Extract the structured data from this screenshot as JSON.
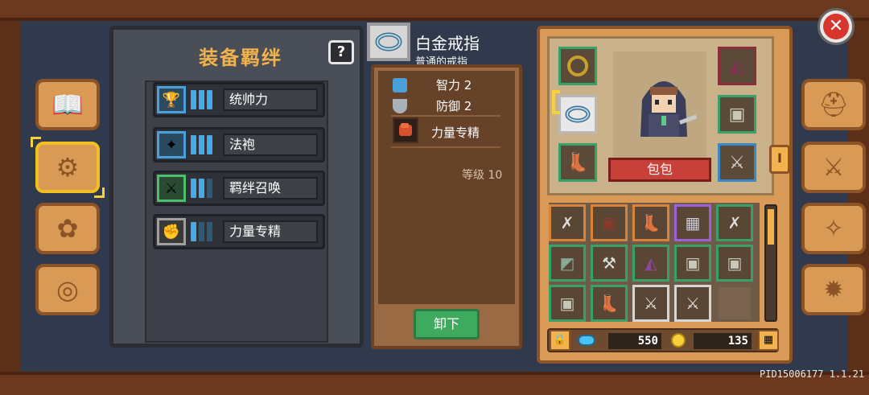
{
  "colors": {
    "accent_gold": "#f2b24d",
    "wood": "#d89a55",
    "green_button": "#3eaa5e",
    "close_red": "#d8362c"
  },
  "left_tabs": [
    {
      "icon": "book-icon",
      "glyph": "📖"
    },
    {
      "icon": "equipment-bond-icon",
      "glyph": "⚙",
      "active": true
    },
    {
      "icon": "pet-icon",
      "glyph": "✿"
    },
    {
      "icon": "steering-wheel-icon",
      "glyph": "◎"
    }
  ],
  "bond": {
    "title": "装备羁绊",
    "help": "?",
    "rows": [
      {
        "label": "统帅力",
        "icon": "trophy-icon",
        "glyph": "🏆",
        "bars_on": 3,
        "bars_total": 3
      },
      {
        "label": "法袍",
        "icon": "robe-icon",
        "glyph": "✦",
        "bars_on": 3,
        "bars_total": 3
      },
      {
        "label": "羁绊召唤",
        "icon": "summon-sword-icon",
        "glyph": "⚔",
        "bars_on": 2,
        "bars_total": 3
      },
      {
        "label": "力量专精",
        "icon": "fist-icon",
        "glyph": "✊",
        "bars_on": 1,
        "bars_total": 3
      }
    ]
  },
  "item": {
    "name": "白金戒指",
    "quality": "普通的戒指",
    "stats": [
      {
        "label": "智力 2",
        "icon": "intelligence-icon",
        "color": "#4aa0d8"
      },
      {
        "label": "防御 2",
        "icon": "defense-shield-icon",
        "color": "#a8b0b8"
      }
    ],
    "skill": "力量专精",
    "level": "等级 10",
    "unequip": "卸下"
  },
  "equipment": {
    "bag_label": "包包",
    "currency": {
      "gems": "550",
      "coins": "135"
    }
  },
  "right_tabs": [
    {
      "icon": "helmet-icon",
      "glyph": "⛑"
    },
    {
      "icon": "crossed-swords-icon",
      "glyph": "⚔"
    },
    {
      "icon": "compass-icon",
      "glyph": "✧"
    },
    {
      "icon": "gear-icon",
      "glyph": "✹"
    }
  ],
  "right_marker": "I",
  "close": "✕",
  "version": "PID15006177 1.1.21"
}
